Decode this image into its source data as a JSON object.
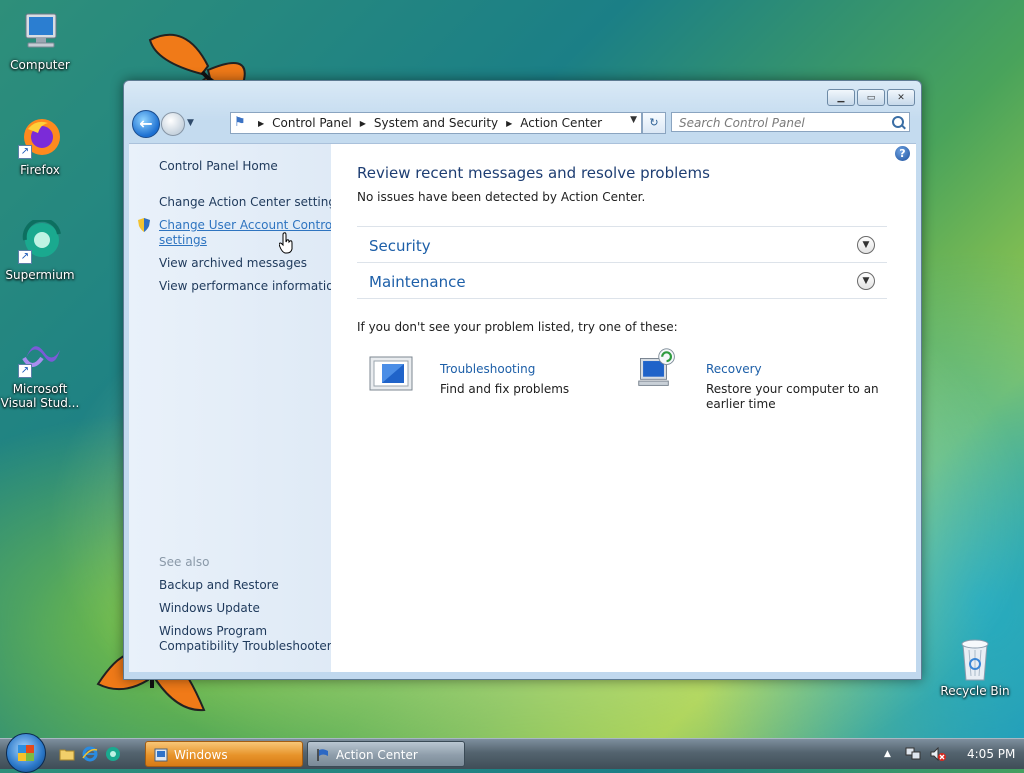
{
  "desktop": {
    "icons": [
      {
        "label": "Computer"
      },
      {
        "label": "Firefox"
      },
      {
        "label": "Supermium"
      },
      {
        "label": "Microsoft Visual Stud..."
      },
      {
        "label": "Recycle Bin"
      }
    ]
  },
  "window": {
    "address": {
      "crumbs": [
        "Control Panel",
        "System and Security",
        "Action Center"
      ]
    },
    "search": {
      "placeholder": "Search Control Panel"
    },
    "sidebar": {
      "home": "Control Panel Home",
      "links": [
        "Change Action Center settings",
        "Change User Account Control settings",
        "View archived messages",
        "View performance information"
      ],
      "uac_line1": "Change User Account Control",
      "uac_line2": "settings",
      "see_also_heading": "See also",
      "see_also": [
        "Backup and Restore",
        "Windows Update",
        "Windows Program",
        "Compatibility Troubleshooter"
      ]
    },
    "content": {
      "heading": "Review recent messages and resolve problems",
      "status": "No issues have been detected by Action Center.",
      "sections": [
        "Security",
        "Maintenance"
      ],
      "try_text": "If you don't see your problem listed, try one of these:",
      "troubleshooting": {
        "title": "Troubleshooting",
        "desc": "Find and fix problems"
      },
      "recovery": {
        "title": "Recovery",
        "desc_line1": "Restore your computer to an",
        "desc_line2": "earlier time"
      }
    }
  },
  "taskbar": {
    "buttons": [
      "Windows",
      "Action Center"
    ],
    "clock": "4:05 PM"
  }
}
